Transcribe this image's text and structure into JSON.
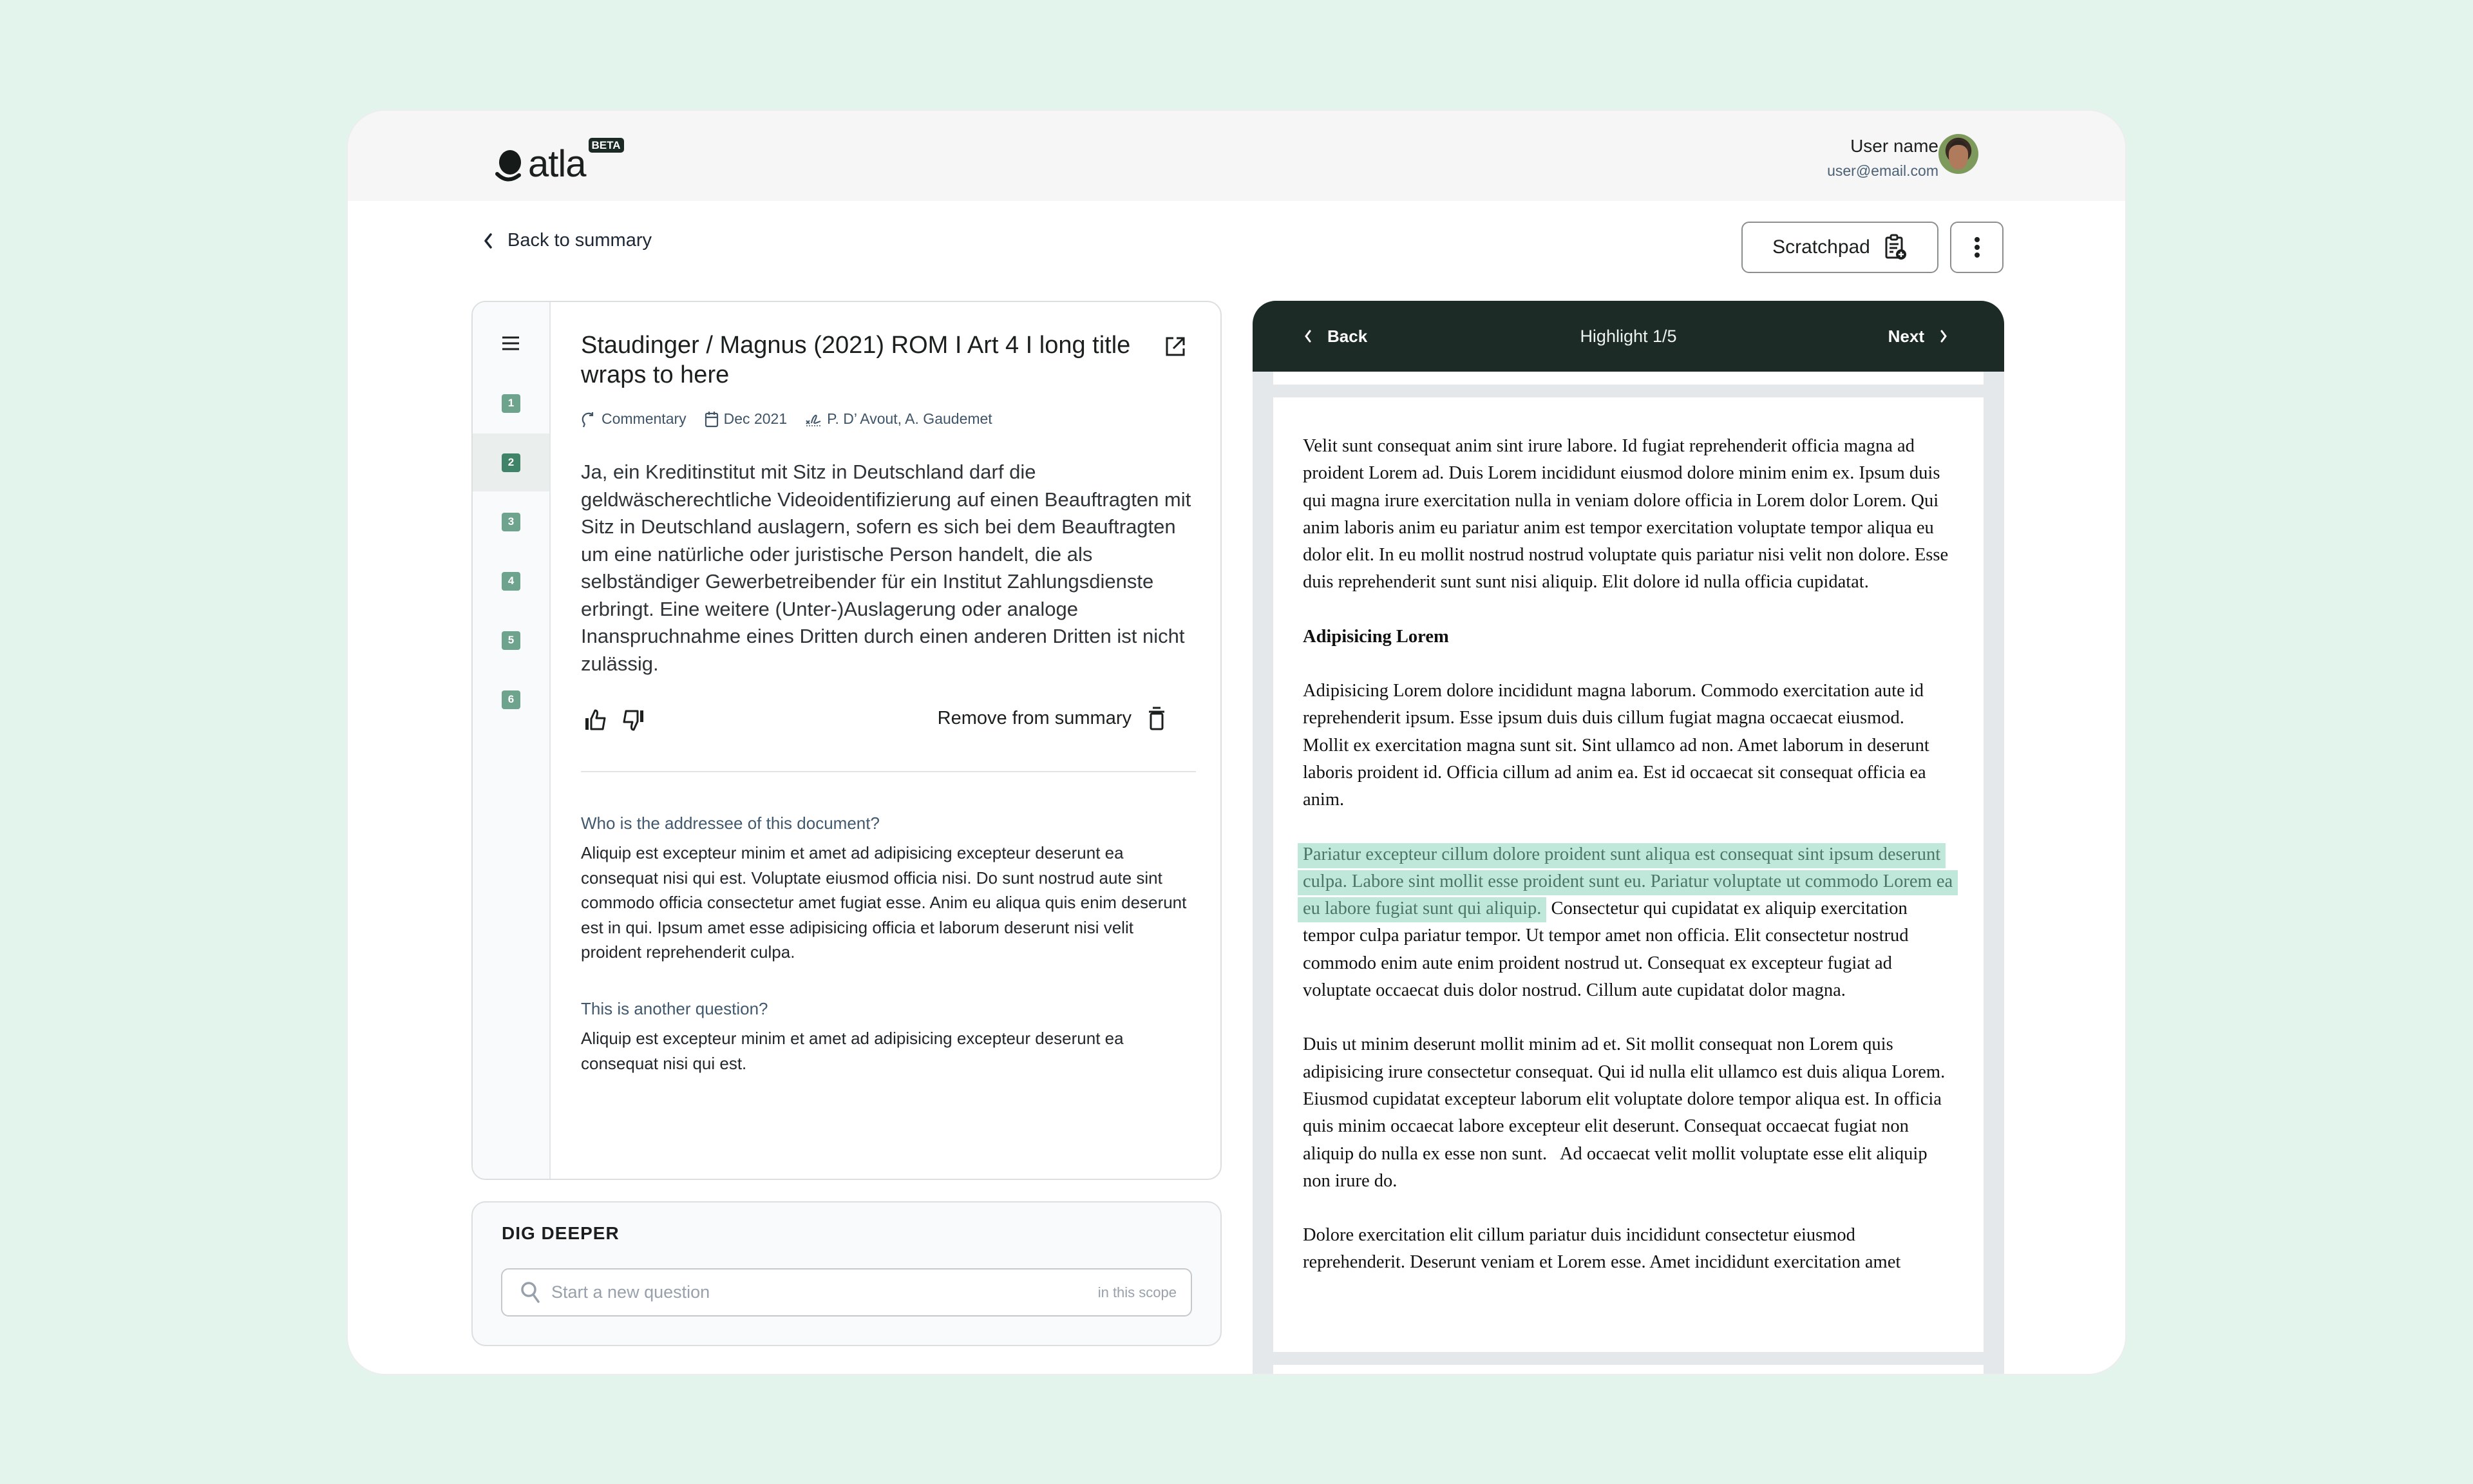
{
  "app": {
    "logo_text": "atla",
    "logo_badge": "BETA"
  },
  "user": {
    "name": "User name",
    "email": "user@email.com",
    "avatar_icon": "user-avatar-photo"
  },
  "nav": {
    "back_label": "Back to summary"
  },
  "toolbar": {
    "scratchpad_label": "Scratchpad",
    "scratchpad_icon": "clipboard-add-icon",
    "more_icon": "vertical-dots-icon"
  },
  "sidebar": {
    "menu_icon": "hamburger-icon",
    "items": [
      {
        "label": "1",
        "active": false
      },
      {
        "label": "2",
        "active": true
      },
      {
        "label": "3",
        "active": false
      },
      {
        "label": "4",
        "active": false
      },
      {
        "label": "5",
        "active": false
      },
      {
        "label": "6",
        "active": false
      }
    ]
  },
  "summary": {
    "title": "Staudinger / Magnus (2021) ROM I Art 4 I long title wraps to here",
    "meta": {
      "type": "Commentary",
      "date": "Dec 2021",
      "authors": "P. D’ Avout, A. Gaudemet"
    },
    "answer": "Ja, ein Kreditinstitut mit Sitz in Deutschland darf die geldwäscherechtliche Videoidentifizierung auf einen Beauftragten mit Sitz in Deutschland auslagern, sofern es sich bei dem Beauftragten um eine natürliche oder juristische Person handelt, die als selbständiger Gewerbetreibender für ein Institut Zahlungsdienste erbringt. Eine weitere (Unter-)Auslagerung oder analoge Inanspruchnahme eines Dritten durch einen anderen Dritten ist nicht zulässig.",
    "remove_label": "Remove from summary",
    "qa": [
      {
        "question": "Who is the addressee of this document?",
        "answer": "Aliquip est excepteur minim et amet ad adipisicing excepteur deserunt ea consequat nisi qui est. Voluptate eiusmod officia nisi. Do sunt nostrud aute sint commodo officia consectetur amet fugiat esse. Anim eu aliqua quis enim deserunt est in qui. Ipsum amet esse adipisicing officia et laborum deserunt nisi velit proident reprehenderit culpa."
      },
      {
        "question": "This is another question?",
        "answer": "Aliquip est excepteur minim et amet ad adipisicing excepteur deserunt ea consequat nisi qui est."
      }
    ]
  },
  "dig_deeper": {
    "title": "DIG DEEPER",
    "input_value": "",
    "placeholder": "Start a new question",
    "scope_hint": "in this scope"
  },
  "viewer": {
    "back_label": "Back",
    "title": "Highlight 1/5",
    "next_label": "Next",
    "highlight_color": "#bfe7da",
    "header_color": "#1c2b25",
    "paragraphs": [
      "Velit sunt consequat anim sint irure labore. Id fugiat reprehenderit officia magna ad proident Lorem ad. Duis Lorem incididunt eiusmod dolore minim enim ex. Ipsum duis qui magna irure exercitation nulla in veniam dolore officia in Lorem dolor Lorem. Qui anim laboris anim eu pariatur anim est tempor exercitation voluptate tempor aliqua eu dolor elit. In eu mollit nostrud nostrud voluptate quis pariatur nisi velit non dolore. Esse duis reprehenderit sunt sunt nisi aliquip. Elit dolore id nulla officia cupidatat."
    ],
    "heading": "Adipisicing Lorem",
    "paragraph_2": "Adipisicing Lorem dolore incididunt magna laborum. Commodo exercitation aute id reprehenderit ipsum. Esse ipsum duis duis cillum fugiat magna occaecat eiusmod. Mollit ex exercitation magna sunt sit. Sint ullamco ad non. Amet laborum in deserunt laboris proident id. Officia cillum ad anim ea. Est id occaecat sit consequat officia ea anim.",
    "highlighted_text": "Pariatur excepteur cillum dolore proident sunt aliqua est consequat sint ipsum deserunt culpa. Labore sint mollit esse proident sunt eu. Pariatur voluptate ut commodo Lorem ea eu labore fugiat sunt qui aliquip.",
    "paragraph_3_rest": " Consectetur qui cupidatat ex aliquip exercitation tempor culpa pariatur tempor. Ut tempor amet non officia. Elit consectetur nostrud commodo enim aute enim proident nostrud ut. Consequat ex excepteur fugiat ad voluptate occaecat duis dolor nostrud. Cillum aute cupidatat dolor magna.",
    "paragraph_4": "Duis ut minim deserunt mollit minim ad et. Sit mollit consequat non Lorem quis adipisicing irure consectetur consequat. Qui id nulla elit ullamco est duis aliqua Lorem. Eiusmod cupidatat excepteur laborum elit voluptate dolore tempor aliqua est. In officia quis minim occaecat labore excepteur elit deserunt. Consequat occaecat fugiat non aliquip do nulla ex esse non sunt.   Ad occaecat velit mollit voluptate esse elit aliquip non irure do.",
    "paragraph_5": "Dolore exercitation elit cillum pariatur duis incididunt consectetur eiusmod reprehenderit. Deserunt veniam et Lorem esse. Amet incididunt exercitation amet"
  }
}
